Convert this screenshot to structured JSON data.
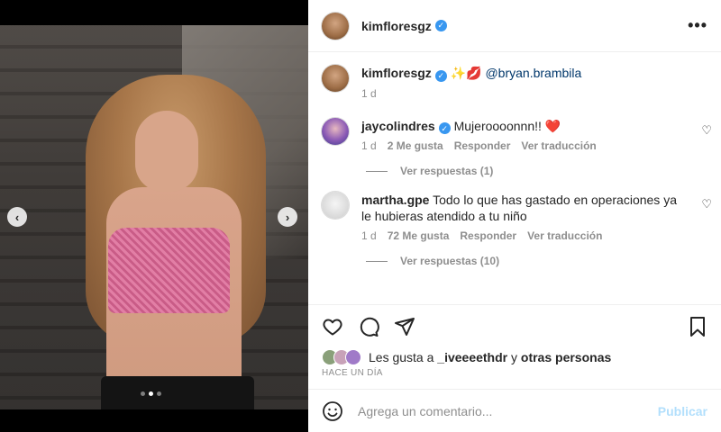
{
  "post": {
    "username": "kimfloresgz"
  },
  "media": {
    "prev_label": "‹",
    "next_label": "›",
    "slides": 3,
    "active_slide": 2
  },
  "caption": {
    "username": "kimfloresgz",
    "sparkles": "✨",
    "kiss": "💋",
    "mention": "@bryan.brambila",
    "time": "1 d"
  },
  "comments": [
    {
      "username": "jaycolindres",
      "verified": true,
      "text": "Mujeroooonnn!! ❤️",
      "time": "1 d",
      "likes": "2 Me gusta",
      "reply": "Responder",
      "translate": "Ver traducción",
      "replies": "Ver respuestas (1)"
    },
    {
      "username": "martha.gpe",
      "verified": false,
      "text": "Todo lo que has gastado en operaciones ya le hubieras atendido a tu niño",
      "time": "1 d",
      "likes": "72 Me gusta",
      "reply": "Responder",
      "translate": "Ver traducción",
      "replies": "Ver respuestas (10)"
    }
  ],
  "likes": {
    "prefix": "Les gusta a",
    "user": "_iveeeethdr",
    "joiner": "y",
    "others": "otras personas"
  },
  "timestamp": "HACE UN DÍA",
  "add_comment": {
    "placeholder": "Agrega un comentario...",
    "publish": "Publicar"
  },
  "colors": {
    "verified": "#3897f0",
    "publish_disabled": "#b2dffc",
    "mention": "#00376b"
  }
}
